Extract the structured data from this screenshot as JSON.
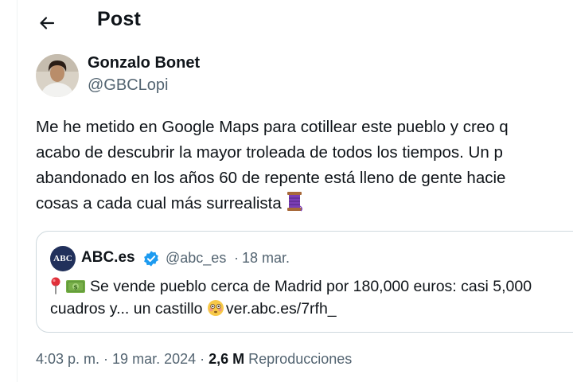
{
  "header": {
    "title": "Post",
    "back_icon": "arrow-left-icon"
  },
  "author": {
    "name": "Gonzalo Bonet",
    "handle": "@GBCLopi"
  },
  "tweet": {
    "lines": [
      "Me he metido en Google Maps para cotillear este pueblo y creo q",
      "acabo de descubrir la mayor troleada de todos los tiempos. Un p",
      "abandonado en los años 60 de repente está lleno de gente hacie",
      "cosas a cada cual más surrealista"
    ],
    "trailing_emoji": "thread-spool-icon"
  },
  "quoted": {
    "avatar_text": "ABC",
    "name": "ABC.es",
    "verified_icon": "verified-badge-icon",
    "handle": "@abc_es",
    "separator": "·",
    "date": "18 mar.",
    "line1": "Se vende pueblo cerca de Madrid por 180,000 euros: casi 5,000",
    "line2_text": "cuadros y... un castillo",
    "line2_link": "ver.abc.es/7rfh_",
    "icons": [
      "round-pushpin-icon",
      "dollar-banknote-icon",
      "flushed-face-icon"
    ]
  },
  "meta": {
    "time": "4:03 p. m.",
    "sep1": " · ",
    "date": "19 mar. 2024",
    "sep2": " · ",
    "views": "2,6 M",
    "views_label": "Reproducciones"
  },
  "colors": {
    "text": "#0f1419",
    "secondary": "#536471",
    "border": "#cfd9de",
    "verified": "#1d9bf0",
    "abc_brand": "#21305b"
  }
}
